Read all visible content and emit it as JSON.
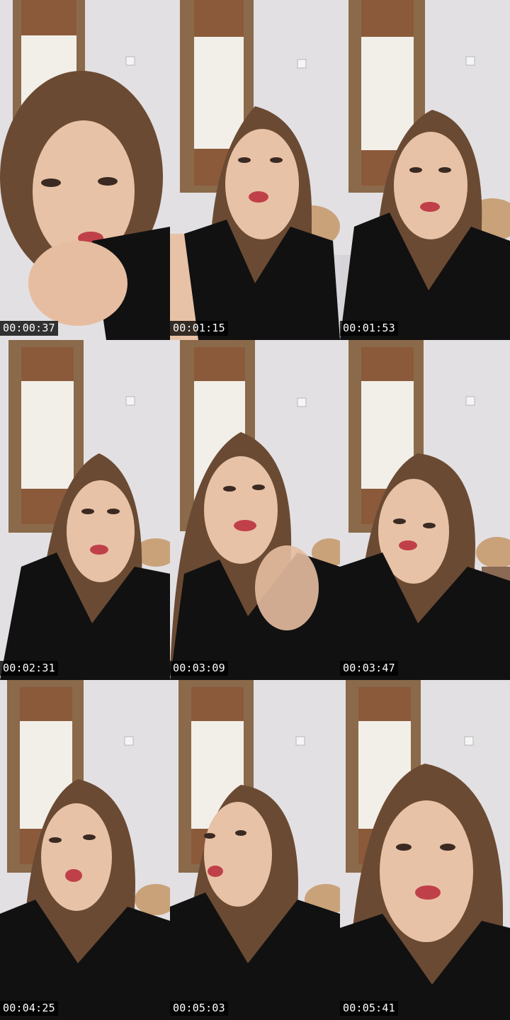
{
  "frames": [
    {
      "timestamp": "00:00:37"
    },
    {
      "timestamp": "00:01:15"
    },
    {
      "timestamp": "00:01:53"
    },
    {
      "timestamp": "00:02:31"
    },
    {
      "timestamp": "00:03:09"
    },
    {
      "timestamp": "00:03:47"
    },
    {
      "timestamp": "00:04:25"
    },
    {
      "timestamp": "00:05:03"
    },
    {
      "timestamp": "00:05:41"
    }
  ],
  "colors": {
    "wall": "#e2e0e3",
    "wall_shade": "#cfcdd1",
    "door_frame": "#8a6a4a",
    "curtain": "#f2efe9",
    "curtain_top": "#8b5a3a",
    "hair": "#6b4a33",
    "skin": "#e8c2a6",
    "top": "#111111",
    "lips": "#c0404a",
    "floor": "#a07a58",
    "timestamp_bg": "#000000",
    "timestamp_text": "#ffffff"
  }
}
